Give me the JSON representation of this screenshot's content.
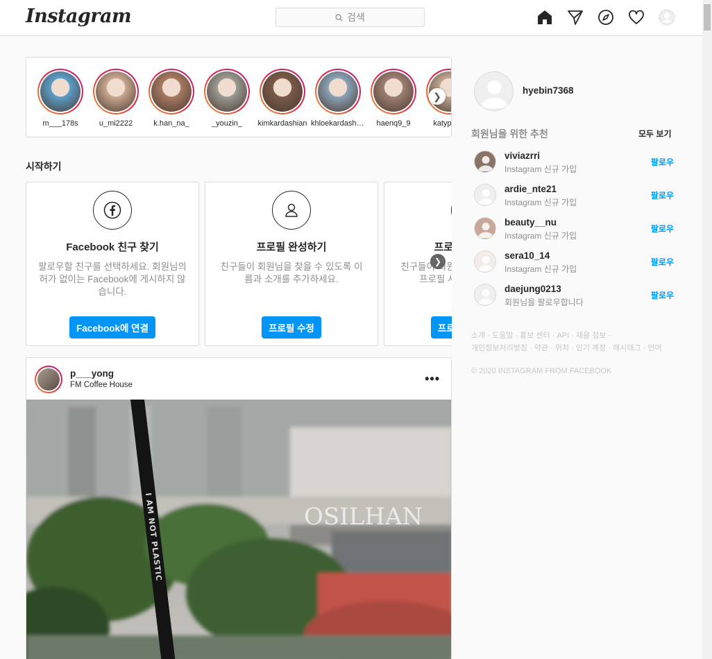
{
  "header": {
    "logo": "Instagram",
    "search_placeholder": "검색",
    "icons": [
      "home-icon",
      "direct-icon",
      "explore-icon",
      "heart-icon",
      "profile-icon"
    ]
  },
  "stories": [
    {
      "name": "m___178s",
      "color": "#5a9fc9"
    },
    {
      "name": "u_mi2222",
      "color": "#c9a88f"
    },
    {
      "name": "k.han_na_",
      "color": "#a87a62"
    },
    {
      "name": "_youzin_",
      "color": "#9b9a94"
    },
    {
      "name": "kimkardashian",
      "color": "#7a5a48"
    },
    {
      "name": "khloekardashian",
      "color": "#8aa3b8"
    },
    {
      "name": "haenq9_9",
      "color": "#9e7f72"
    },
    {
      "name": "katyperry",
      "color": "#c1a891"
    }
  ],
  "getting_started": {
    "title": "시작하기",
    "cards": [
      {
        "title": "Facebook 친구 찾기",
        "desc": "팔로우할 친구를 선택하세요. 회원님의 허가 없이는 Facebook에 게시하지 않습니다.",
        "button": "Facebook에 연결",
        "icon": "facebook-icon"
      },
      {
        "title": "프로필 완성하기",
        "desc": "친구들이 회원님을 찾을 수 있도록 이름과 소개를 추가하세요.",
        "button": "프로필 수정",
        "icon": "user-icon"
      },
      {
        "title": "프로필 사진 추가",
        "desc": "친구들이 회원님을 알아볼 수 있도록 프로필 사진을 추가하세요.",
        "button": "프로필 사진 추가",
        "icon": "camera-icon"
      }
    ]
  },
  "post": {
    "username": "p___yong",
    "location": "FM Coffee House",
    "more": "•••",
    "straw_text": "I AM NOT PLASTIC",
    "sign_text": "OSILHAN"
  },
  "sidebar": {
    "username": "hyebin7368",
    "suggest_title": "회원님을 위한 추천",
    "see_all": "모두 보기",
    "follow_label": "팔로우",
    "suggestions": [
      {
        "name": "viviazrri",
        "sub": "Instagram 신규 가입",
        "color": "#8a7466"
      },
      {
        "name": "ardie_nte21",
        "sub": "Instagram 신규 가입",
        "color": "#efefef"
      },
      {
        "name": "beauty__nu",
        "sub": "Instagram 신규 가입",
        "color": "#c9a89a"
      },
      {
        "name": "sera10_14",
        "sub": "Instagram 신규 가입",
        "color": "#f2ede8"
      },
      {
        "name": "daejung0213",
        "sub": "회원님을 팔로우합니다",
        "color": "#efefef"
      }
    ],
    "footer_line1": "소개 · 도움말 · 홍보 센터 · API · 채용 정보 ·",
    "footer_line2": "개인정보처리방침 · 약관 · 위치 · 인기 계정 · 해시태그 · 언어",
    "copyright": "© 2020 INSTAGRAM FROM FACEBOOK"
  }
}
